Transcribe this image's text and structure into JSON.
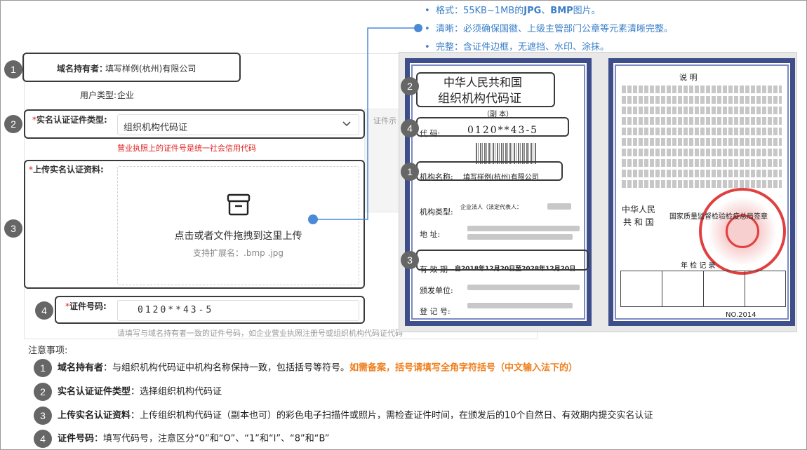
{
  "bullets": [
    {
      "prefix": "格式：55KB~1MB的",
      "b1": "JPG",
      "mid": "、",
      "b2": "BMP",
      "suffix": "图片。"
    },
    {
      "text": "清晰：必须确保国徽、上级主管部门公章等元素清晰完整。"
    },
    {
      "text": "完整：含证件边框，无遮挡、水印、涂抹。"
    }
  ],
  "form": {
    "holder_label": "域名持有者：",
    "holder_value": "填写样例(杭州)有限公司",
    "user_type_label": "用户类型:",
    "user_type_value": "企业",
    "cert_type_label": "实名认证证件类型:",
    "cert_type_value": "组织机构代码证",
    "cert_type_hint": "营业执照上的证件号是统一社会信用代码",
    "side_stub": "证件示",
    "upload_label": "上传实名认证资料:",
    "upload_main": "点击或者文件拖拽到这里上传",
    "upload_sub": "支持扩展名：.bmp .jpg",
    "cert_no_label": "证件号码:",
    "cert_no_value": "0120**43-5",
    "cert_no_tip": "请填写与域名持有者一致的证件号码，如企业营业执照注册号或组织机构代码证代码",
    "required_mark": "*"
  },
  "certificate": {
    "title1": "中华人民共和国",
    "title2": "组织机构代码证",
    "copy": "（副  本）",
    "code_label": "代      码:",
    "code_value": "0120**43-5",
    "org_label": "机构名称:",
    "org_value": "填写样例(杭州)有限公司",
    "type_label": "机构类型:",
    "type_value": "企业法人（法定代表人：",
    "addr_label": "地       址:",
    "valid_label": "有  效  期",
    "valid_value": "自2018年12月20日至2028年12月20日",
    "issuer_label": "颁发单位:",
    "reg_label": "登  记  号:",
    "back_title": "说        明",
    "back_country1": "中华人民",
    "back_country2": "共 和 国",
    "back_authority": "国家质量监督检验检疫总局签章",
    "back_check": "年 检 记 录",
    "back_no": "NO.2014"
  },
  "notes": {
    "title": "注意事项:",
    "items": [
      {
        "num": "1",
        "bold": "域名持有者",
        "text": "：与组织机构代码证中机构名称保持一致，包括括号等符号。",
        "orange": "如需备案，括号请填写全角字符括号（中文输入法下的）"
      },
      {
        "num": "2",
        "bold": "实名认证证件类型",
        "text": "：选择组织机构代码证",
        "orange": ""
      },
      {
        "num": "3",
        "bold": "上传实名认证资料",
        "text": "：上传组织机构代码证（副本也可）的彩色电子扫描件或照片，需检查证件时间，在颁发后的10个自然日、有效期内提交实名认证",
        "orange": ""
      },
      {
        "num": "4",
        "bold": "证件号码",
        "text": "：填写代码号，注意区分“0”和“O”、“1”和“l”、“8”和“B”",
        "orange": ""
      }
    ]
  },
  "markers": [
    "1",
    "2",
    "3",
    "4"
  ],
  "colors": {
    "accent_blue": "#3a7fc8",
    "required_red": "#e02020",
    "warning_orange": "#ef7d18",
    "marker_gray": "#666666"
  }
}
